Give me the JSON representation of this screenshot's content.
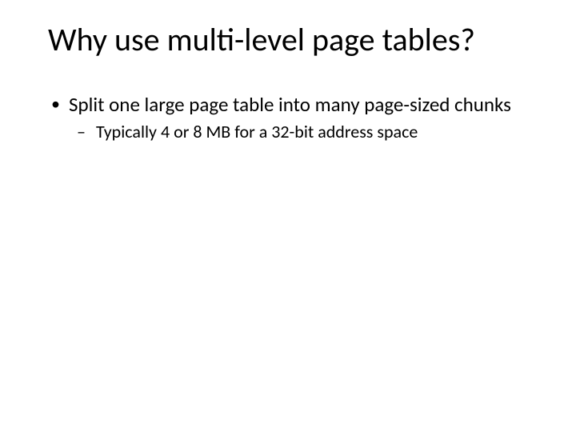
{
  "slide": {
    "title": "Why use multi-level page tables?",
    "bullets": [
      {
        "text": "Split one large page table into many page-sized chunks",
        "sub": [
          {
            "text": "Typically 4 or 8 MB for a 32-bit address space"
          }
        ]
      }
    ]
  }
}
